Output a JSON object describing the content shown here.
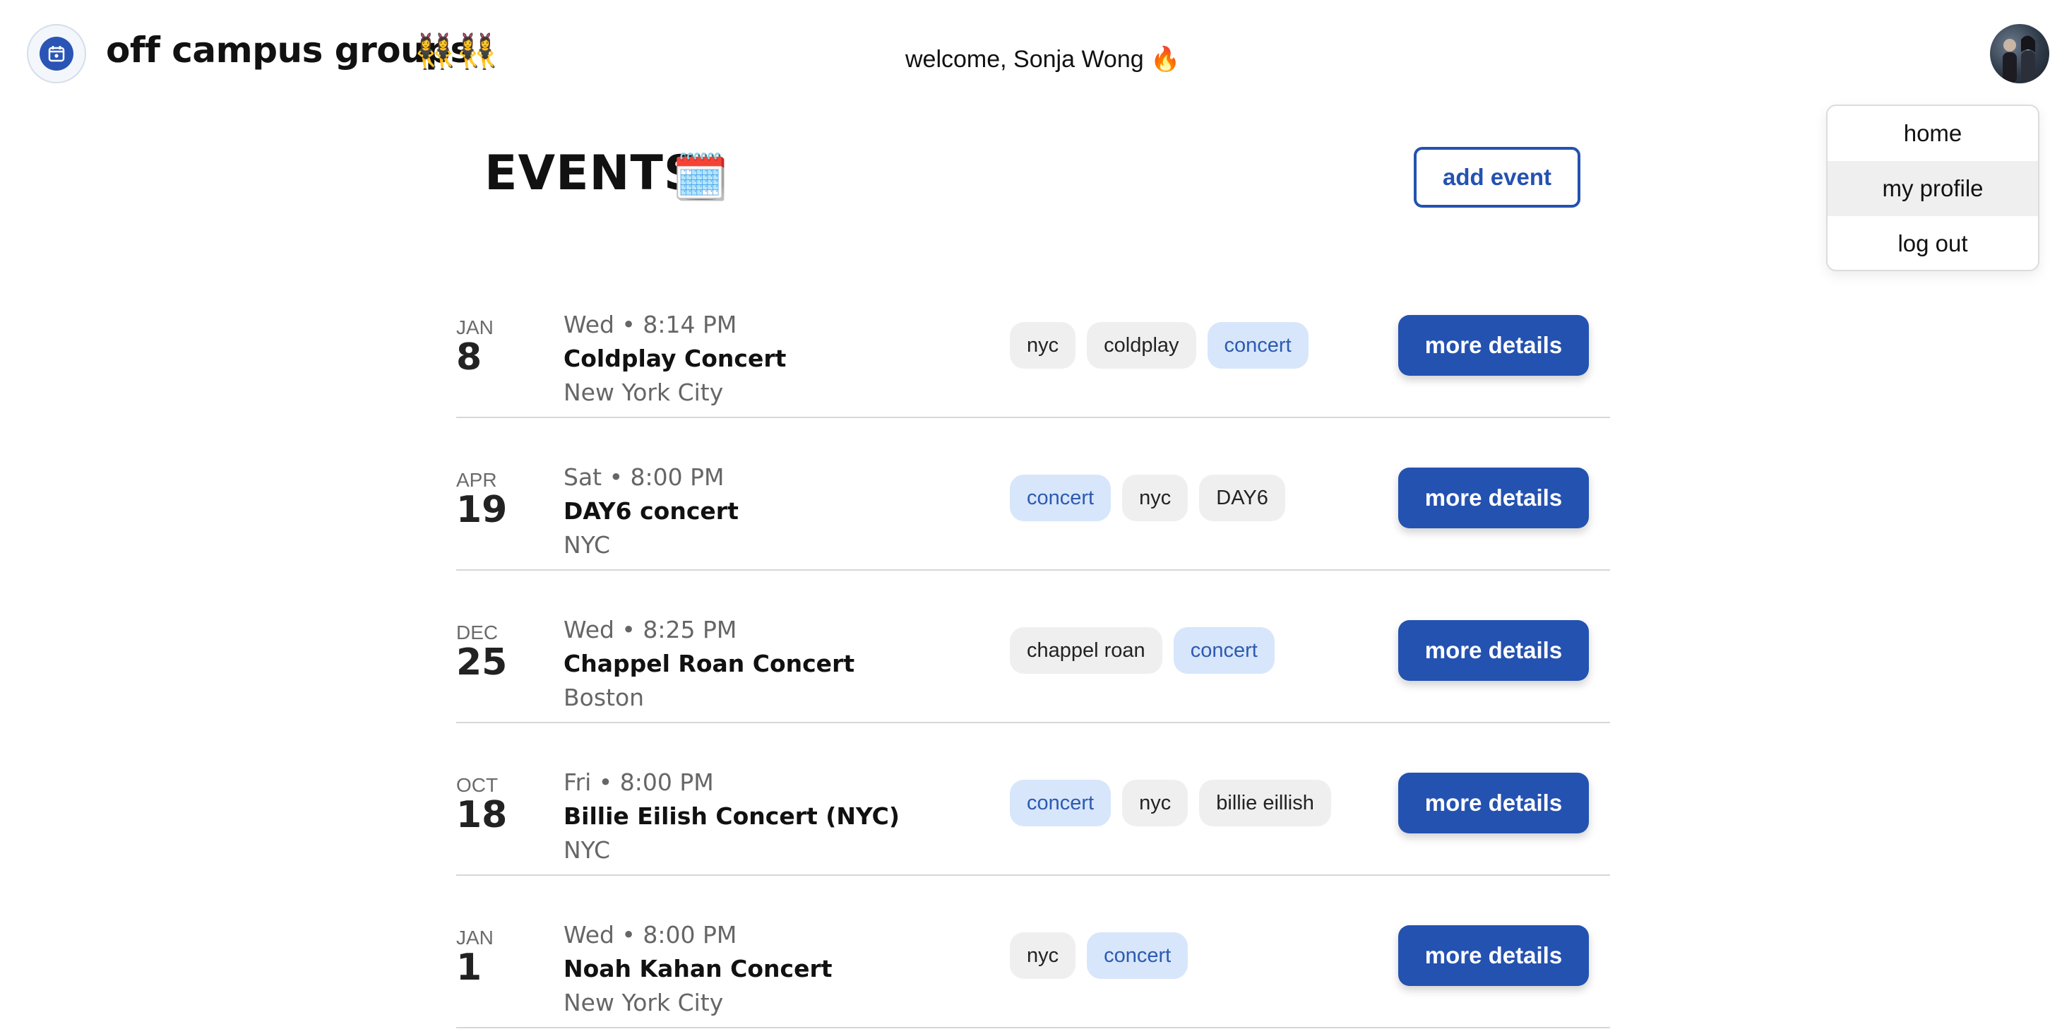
{
  "header": {
    "brand": "off campus groups",
    "brand_emoji": "👯‍♀️👯‍♀️",
    "welcome": "welcome, Sonja Wong 🔥"
  },
  "menu": {
    "items": [
      "home",
      "my profile",
      "log out"
    ],
    "highlighted": "my profile"
  },
  "page": {
    "title": "EVENTS",
    "title_emoji": "🗓️",
    "add_event_label": "add event"
  },
  "events": [
    {
      "month": "JAN",
      "day": "8",
      "when": "Wed • 8:14 PM",
      "title": "Coldplay Concert",
      "location": "New York City",
      "tags": [
        "nyc",
        "coldplay",
        "concert"
      ],
      "button": "more details"
    },
    {
      "month": "APR",
      "day": "19",
      "when": "Sat • 8:00 PM",
      "title": "DAY6 concert",
      "location": "NYC",
      "tags": [
        "concert",
        "nyc",
        "DAY6"
      ],
      "button": "more details"
    },
    {
      "month": "DEC",
      "day": "25",
      "when": "Wed • 8:25 PM",
      "title": "Chappel Roan Concert",
      "location": "Boston",
      "tags": [
        "chappel roan",
        "concert"
      ],
      "button": "more details"
    },
    {
      "month": "OCT",
      "day": "18",
      "when": "Fri • 8:00 PM",
      "title": "Billie Eilish Concert (NYC)",
      "location": "NYC",
      "tags": [
        "concert",
        "nyc",
        "billie eillish"
      ],
      "button": "more details"
    },
    {
      "month": "JAN",
      "day": "1",
      "when": "Wed • 8:00 PM",
      "title": "Noah Kahan Concert",
      "location": "New York City",
      "tags": [
        "nyc",
        "concert"
      ],
      "button": "more details"
    }
  ],
  "colors": {
    "primary": "#2452b0",
    "accent_tag_bg": "#d7e6fb",
    "accent_tag_text": "#2d5ab0",
    "tag_bg": "#efefef"
  },
  "icons": {
    "logo": "calendar-logo-icon",
    "avatar": "user-avatar"
  }
}
